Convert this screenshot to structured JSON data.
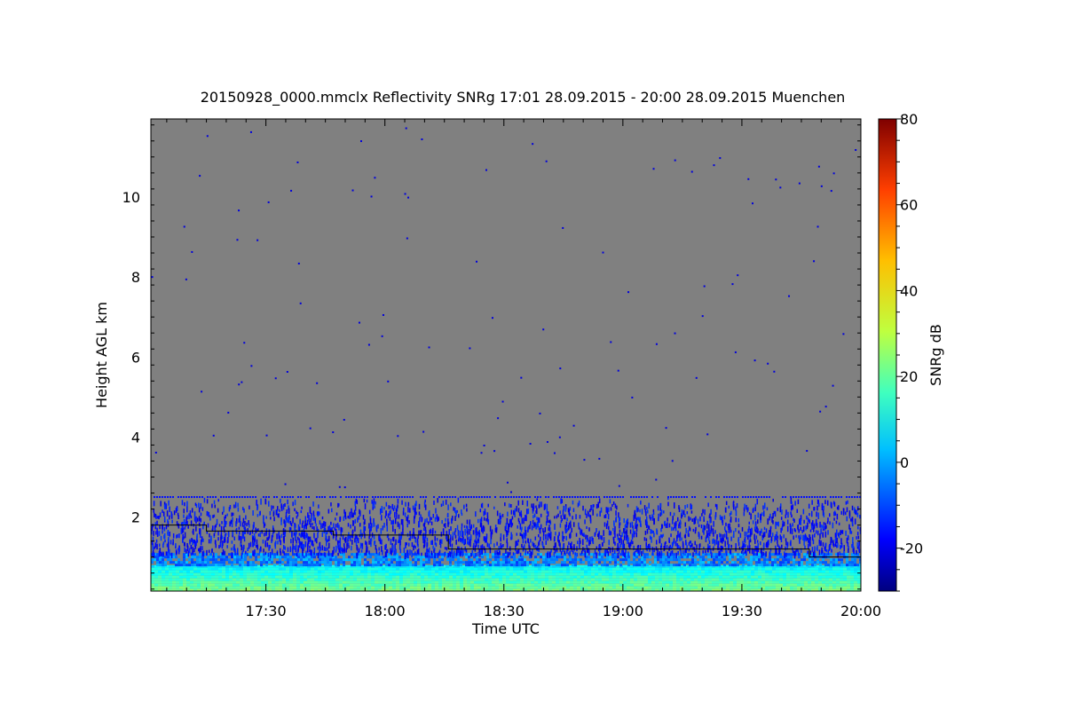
{
  "chart_data": {
    "type": "heatmap",
    "title": "20150928_0000.mmclx Reflectivity SNRg   17:01 28.09.2015 - 20:00 28.09.2015 Muenchen",
    "xlabel": "Time UTC",
    "ylabel": "Height AGL km",
    "xlim": [
      "17:01",
      "20:00"
    ],
    "x_tick_labels": [
      "17:30",
      "18:00",
      "18:30",
      "19:00",
      "19:30",
      "20:00"
    ],
    "ylim": [
      0.15,
      11.95
    ],
    "y_ticks": [
      2,
      4,
      6,
      8,
      10
    ],
    "y_tick_labels": [
      "2",
      "4",
      "6",
      "8",
      "10"
    ],
    "background_color": "#808080",
    "colorbar": {
      "label": "SNRg dB",
      "range": [
        -30,
        80
      ],
      "ticks": [
        -20,
        0,
        20,
        40,
        60,
        80
      ],
      "tick_labels": [
        "-20",
        "0",
        "20",
        "40",
        "60",
        "80"
      ],
      "colormap": "jet"
    },
    "layers": [
      {
        "description": "surface echo",
        "height_km": [
          0.15,
          0.8
        ],
        "snr_db": [
          10,
          25
        ]
      },
      {
        "description": "boundary layer echo",
        "height_km": [
          0.8,
          1.1
        ],
        "snr_db": [
          -10,
          5
        ]
      },
      {
        "description": "sparse clutter",
        "height_km": [
          1.1,
          2.5
        ],
        "snr_db": [
          -20,
          -10
        ]
      },
      {
        "description": "noise line",
        "height_km": [
          2.5,
          2.5
        ],
        "snr_db": [
          -15,
          -15
        ]
      }
    ],
    "boundary_layer_line": [
      {
        "time": "17:01",
        "height_km": 1.8
      },
      {
        "time": "17:15",
        "height_km": 1.65
      },
      {
        "time": "17:47",
        "height_km": 1.55
      },
      {
        "time": "18:16",
        "height_km": 1.2
      },
      {
        "time": "19:47",
        "height_km": 1.0
      },
      {
        "time": "20:00",
        "height_km": 1.0
      }
    ]
  }
}
